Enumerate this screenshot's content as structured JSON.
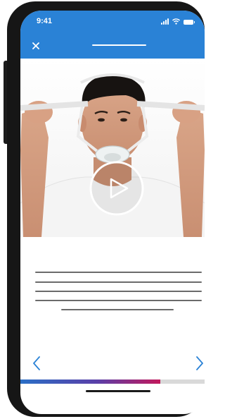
{
  "status_bar": {
    "time": "9:41",
    "icons": [
      "signal-icon",
      "wifi-icon",
      "battery-icon"
    ]
  },
  "nav_bar": {
    "close_icon": "close-icon",
    "background_color": "#2a82d6"
  },
  "video": {
    "description_icon": "play-icon",
    "image_kind": "photo-person-fitting-cpap-mask"
  },
  "pager": {
    "prev_icon": "chevron-left-icon",
    "next_icon": "chevron-right-icon",
    "accent_color": "#2a82d6"
  },
  "progress": {
    "fraction": 0.76,
    "gradient_colors": [
      "#2a6fc6",
      "#5a3fa8",
      "#c2185b"
    ]
  }
}
